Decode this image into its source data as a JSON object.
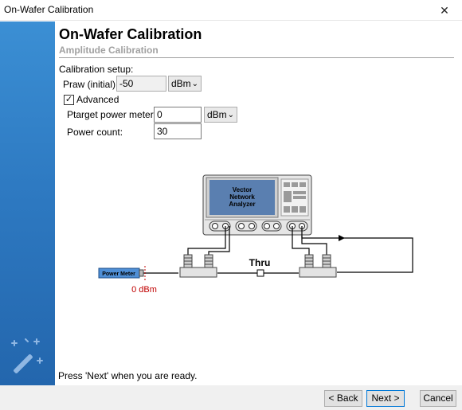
{
  "window": {
    "title": "On-Wafer Calibration",
    "close_glyph": "✕"
  },
  "header": {
    "title": "On-Wafer Calibration",
    "subtitle": "Amplitude Calibration"
  },
  "setup": {
    "section_label": "Calibration setup:",
    "praw_label": "Praw (initial):",
    "praw_value": "-50",
    "praw_unit": "dBm",
    "advanced_label": "Advanced",
    "advanced_checked": true,
    "check_glyph": "✓",
    "ptarget_label": "Ptarget power meter:",
    "ptarget_value": "0",
    "ptarget_unit": "dBm",
    "power_count_label": "Power count:",
    "power_count_value": "30",
    "dropdown_glyph": "⌄"
  },
  "diagram": {
    "vna_label_line1": "Vector",
    "vna_label_line2": "Network",
    "vna_label_line3": "Analyzer",
    "power_meter_label": "Power Meter",
    "power_meter_reading": "0 dBm",
    "thru_label": "Thru",
    "colors": {
      "vna_screen": "#5a7fb0",
      "power_meter": "#4f8fd6",
      "reading": "#c00000"
    }
  },
  "status_text": "Press 'Next' when you are ready.",
  "buttons": {
    "back": "< Back",
    "next": "Next >",
    "cancel": "Cancel"
  },
  "icons": {
    "sidebar": "magic-wand-icon"
  }
}
